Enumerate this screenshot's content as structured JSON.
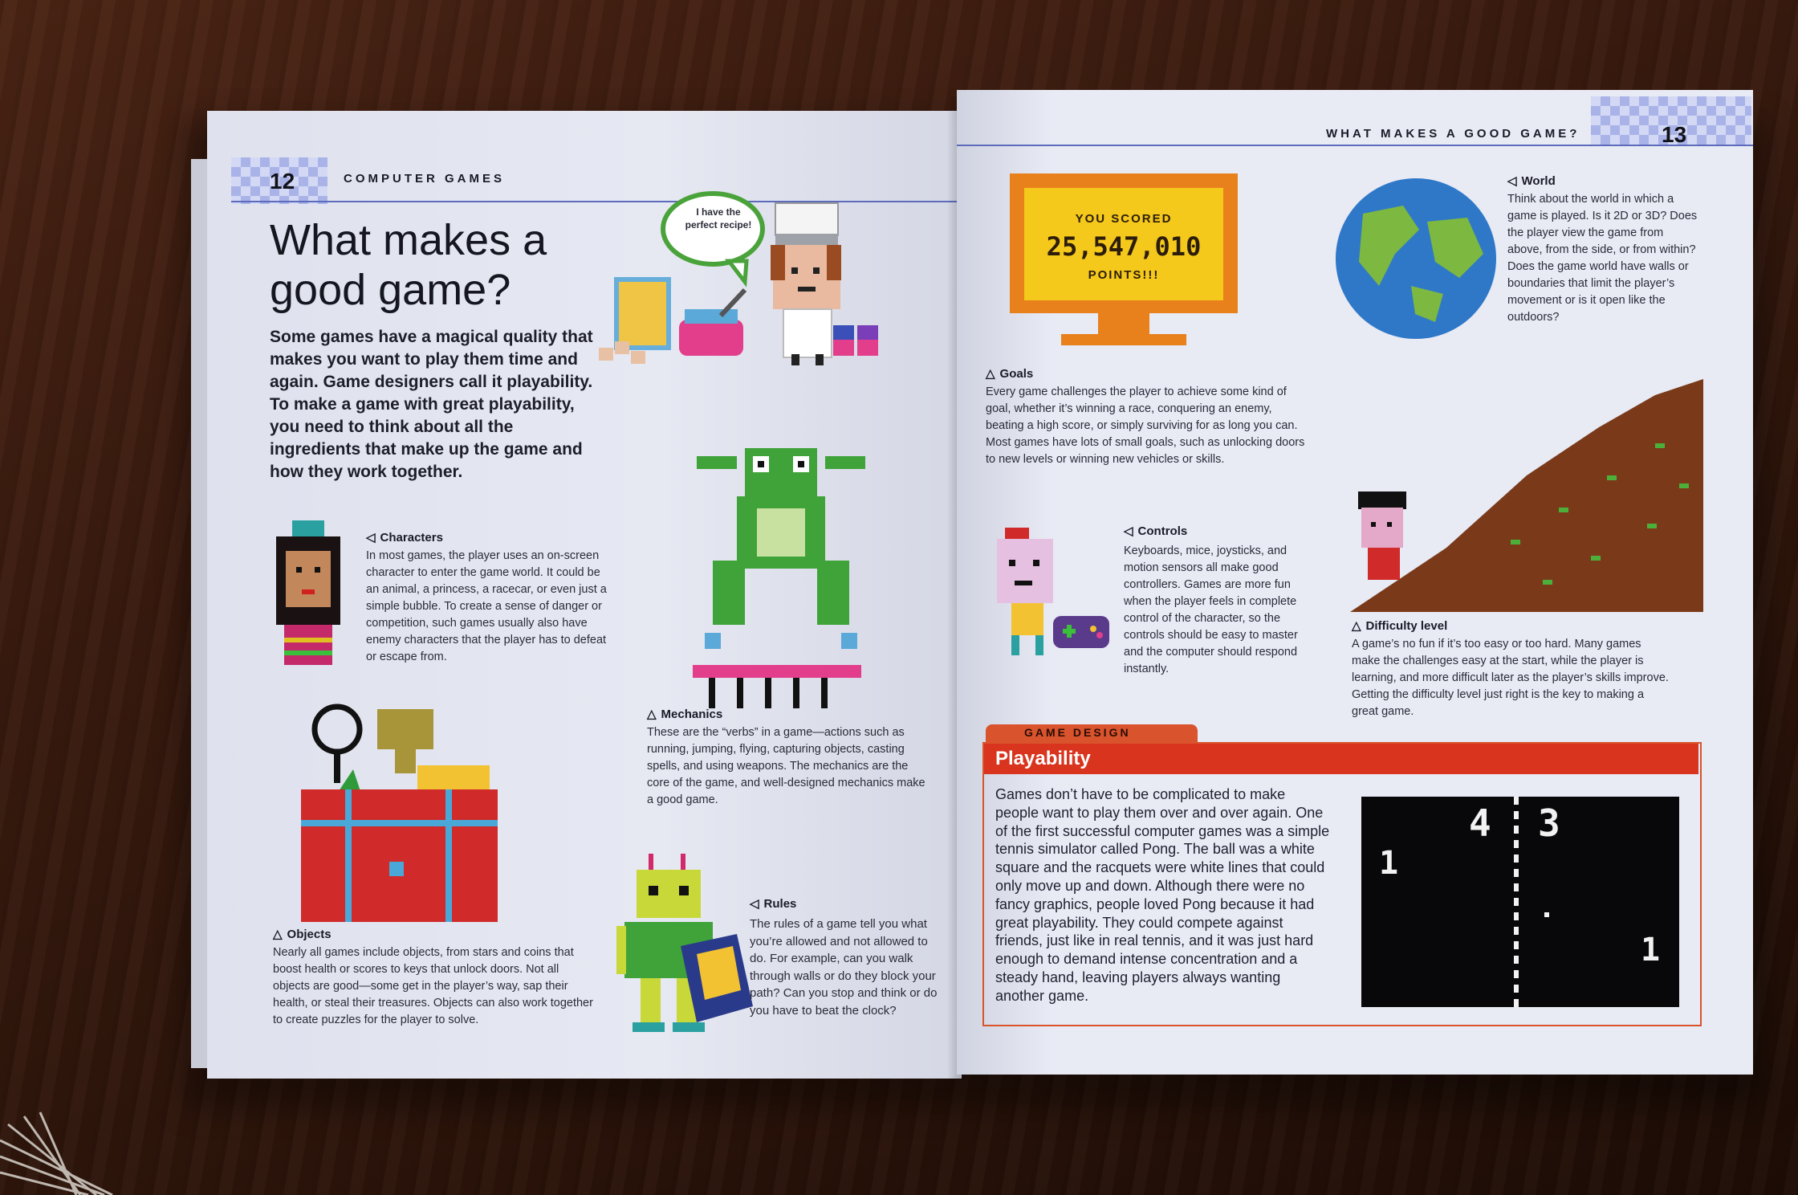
{
  "left_page": {
    "page_number": "12",
    "running_head": "COMPUTER GAMES",
    "title": "What makes a good game?",
    "intro": "Some games have a magical quality that makes you want to play them time and again. Game designers call it playability. To make a game with great playability, you need to think about all the ingredients that make up the game and how they work together.",
    "speech_bubble": "I have the perfect recipe!",
    "sections": {
      "characters": {
        "heading": "Characters",
        "text": "In most games, the player uses an on-screen character to enter the game world. It could be an animal, a princess, a racecar, or even just a simple bubble. To create a sense of danger or competition, such games usually also have enemy characters that the player has to defeat or escape from."
      },
      "mechanics": {
        "heading": "Mechanics",
        "text": "These are the “verbs” in a game—actions such as running, jumping, flying, capturing objects, casting spells, and using weapons. The mechanics are the core of the game, and well-designed mechanics make a good game."
      },
      "objects": {
        "heading": "Objects",
        "text": "Nearly all games include objects, from stars and coins that boost health or scores to keys that unlock doors. Not all objects are good—some get in the player’s way, sap their health, or steal their treasures. Objects can also work together to create puzzles for the player to solve."
      },
      "rules": {
        "heading": "Rules",
        "text": "The rules of a game tell you what you’re allowed and not allowed to do. For example, can you walk through walls or do they block your path? Can you stop and think or do you have to beat the clock?"
      }
    }
  },
  "right_page": {
    "page_number": "13",
    "running_head": "WHAT MAKES A GOOD GAME?",
    "score_screen": {
      "line1": "YOU SCORED",
      "score": "25,547,010",
      "line3": "POINTS!!!"
    },
    "sections": {
      "goals": {
        "heading": "Goals",
        "text": "Every game challenges the player to achieve some kind of goal, whether it’s winning a race, conquering an enemy, beating a high score, or simply surviving for as long you can. Most games have lots of small goals, such as unlocking doors to new levels or winning new vehicles or skills."
      },
      "world": {
        "heading": "World",
        "text": "Think about the world in which a game is played. Is it 2D or 3D? Does the player view the game from above, from the side, or from within? Does the game world have walls or boundaries that limit the player’s movement or is it open like the outdoors?"
      },
      "controls": {
        "heading": "Controls",
        "text": "Keyboards, mice, joysticks, and motion sensors all make good controllers. Games are more fun when the player feels in complete control of the character, so the controls should be easy to master and the computer should respond instantly."
      },
      "difficulty": {
        "heading": "Difficulty level",
        "text": "A game’s no fun if it’s too easy or too hard. Many games make the challenges easy at the start, while the player is learning, and more difficult later as the player’s skills improve. Getting the difficulty level just right is the key to making a great game."
      }
    },
    "game_design": {
      "tab": "GAME DESIGN",
      "title": "Playability",
      "text": "Games don’t have to be complicated to make people want to play them over and over again. One of the first successful computer games was a simple tennis simulator called Pong. The ball was a white square and the racquets were white lines that could only move up and down. Although there were no fancy graphics, people loved Pong because it had great playability. They could compete against friends, just like in real tennis, and it was just hard enough to demand intense concentration and a steady hand, leaving players always wanting another game."
    },
    "pong": {
      "score_left": "4",
      "score_right": "3",
      "label_left": "1",
      "label_right": "1"
    }
  },
  "colors": {
    "accent_red": "#d9341e",
    "score_orange": "#e8801c",
    "score_yellow": "#f5c81c",
    "pixel_band_blue": "#a9b3e8"
  }
}
